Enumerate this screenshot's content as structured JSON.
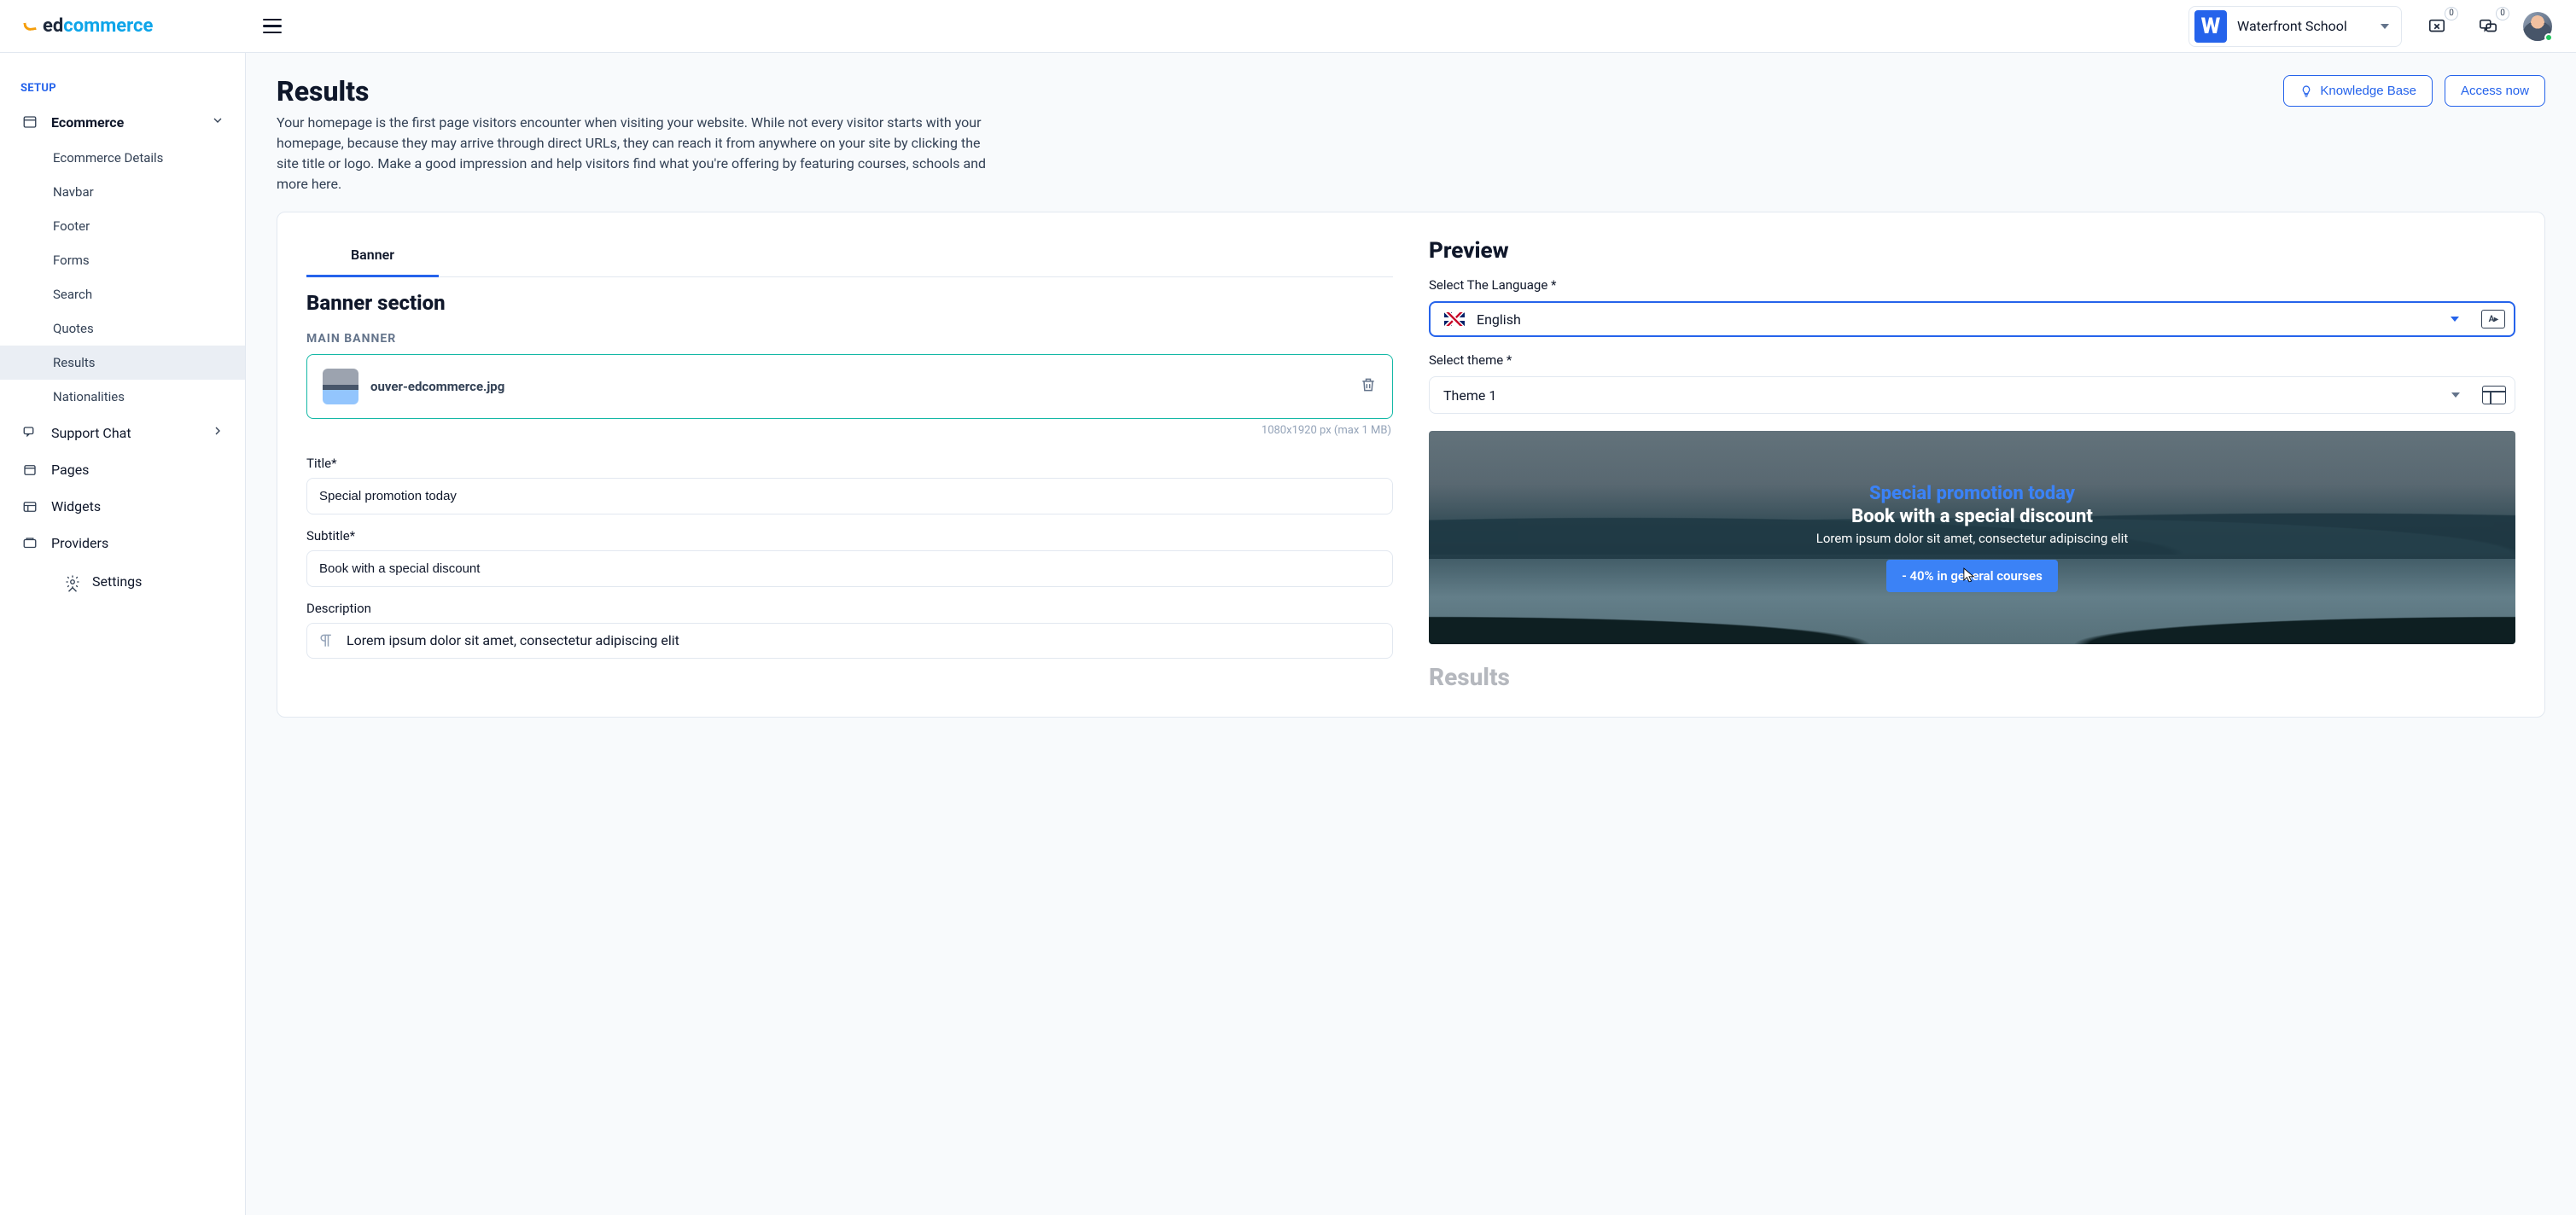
{
  "logo": {
    "prefix": "ed",
    "suffix": "commerce"
  },
  "header": {
    "school": {
      "initial": "W",
      "name": "Waterfront School"
    },
    "icon1_count": "0",
    "icon2_count": "0"
  },
  "sidebar": {
    "section": "SETUP",
    "ecommerce": {
      "label": "Ecommerce",
      "items": [
        {
          "label": "Ecommerce Details"
        },
        {
          "label": "Navbar"
        },
        {
          "label": "Footer"
        },
        {
          "label": "Forms"
        },
        {
          "label": "Search"
        },
        {
          "label": "Quotes"
        },
        {
          "label": "Results",
          "active": true
        },
        {
          "label": "Nationalities"
        }
      ]
    },
    "items": [
      {
        "label": "Support Chat",
        "has_caret": true
      },
      {
        "label": "Pages"
      },
      {
        "label": "Widgets"
      },
      {
        "label": "Providers"
      }
    ],
    "settings": "Settings"
  },
  "page": {
    "title": "Results",
    "desc": "Your homepage is the first page visitors encounter when visiting your website. While not every visitor starts with your homepage, because they may arrive through direct URLs, they can reach it from anywhere on your site by clicking the site title or logo. Make a good impression and help visitors find what you're offering by featuring courses, schools and more here.",
    "kb": "Knowledge Base",
    "access": "Access now"
  },
  "banner": {
    "tab": "Banner",
    "section_title": "Banner section",
    "main_banner_label": "MAIN BANNER",
    "filename": "ouver-edcommerce.jpg",
    "hint": "1080x1920 px (max 1 MB)",
    "title_label": "Title*",
    "title_value": "Special promotion today",
    "subtitle_label": "Subtitle*",
    "subtitle_value": "Book with a special discount",
    "description_label": "Description",
    "description_value": "Lorem ipsum dolor sit amet, consectetur adipiscing elit"
  },
  "preview": {
    "title": "Preview",
    "lang_label": "Select The Language *",
    "lang_value": "English",
    "lang_tile": "A▸",
    "theme_label": "Select theme *",
    "theme_value": "Theme 1",
    "image": {
      "line1": "Special promotion today",
      "line2": "Book with a special discount",
      "line3": "Lorem ipsum dolor sit amet, consectetur adipiscing elit",
      "cta": "- 40% in general courses"
    },
    "below_title": "Results"
  }
}
